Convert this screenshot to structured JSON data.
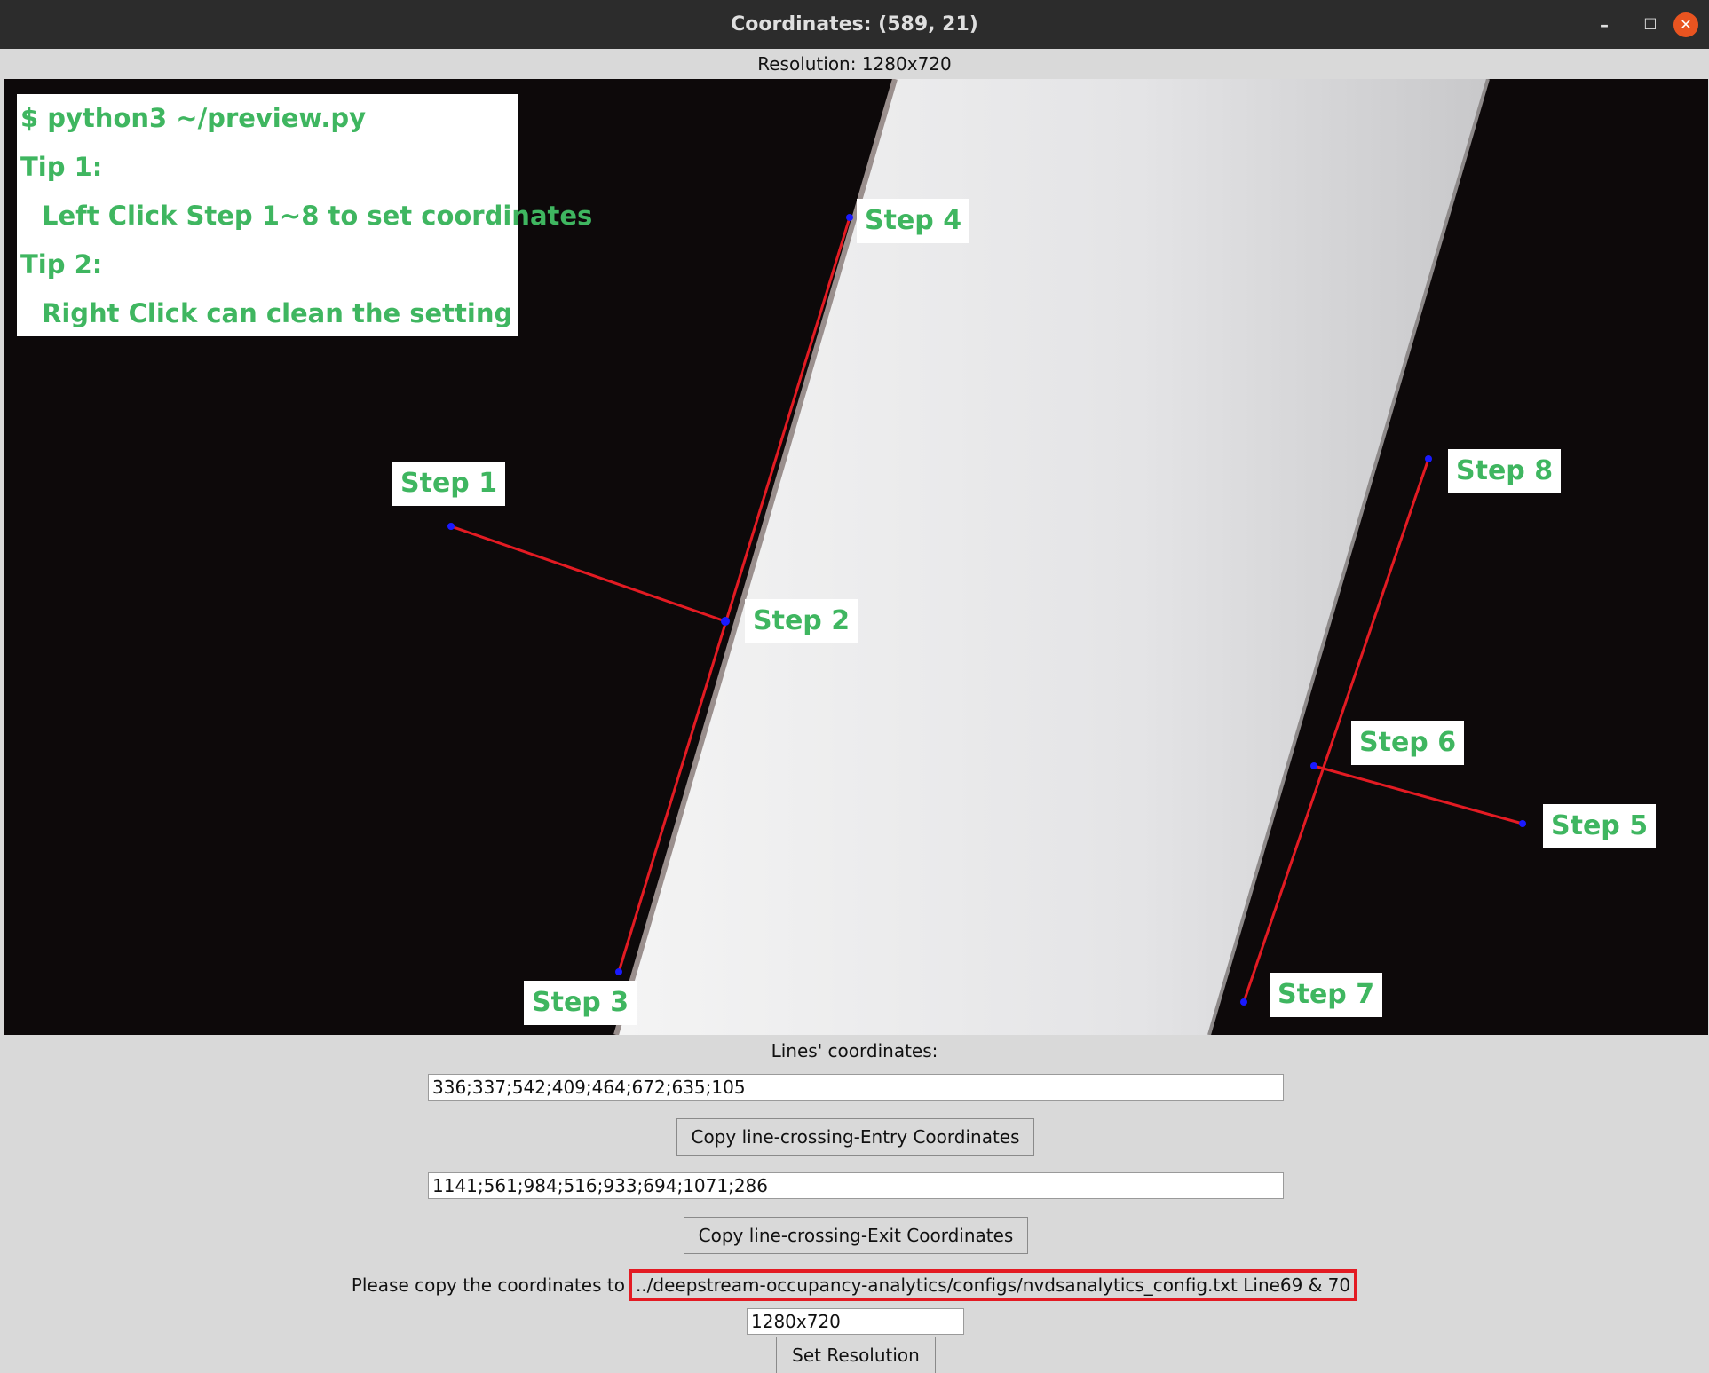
{
  "window": {
    "title": "Coordinates: (589, 21)",
    "minimize_glyph": "–",
    "maximize_glyph": "☐",
    "close_glyph": "✕"
  },
  "resolution_label": "Resolution: 1280x720",
  "overlay": {
    "command": "$ python3 ~/preview.py",
    "tip1_title": "Tip 1:",
    "tip1_text": "Left Click Step 1~8 to set coordinates",
    "tip2_title": "Tip 2:",
    "tip2_text": "Right Click can clean the setting"
  },
  "steps": {
    "s1": "Step 1",
    "s2": "Step 2",
    "s3": "Step 3",
    "s4": "Step 4",
    "s5": "Step 5",
    "s6": "Step 6",
    "s7": "Step 7",
    "s8": "Step 8"
  },
  "colors": {
    "line": "#e31b23",
    "point": "#1a1aff",
    "text_green": "#3fb660"
  },
  "form": {
    "lines_label": "Lines' coordinates:",
    "entry_value": "336;337;542;409;464;672;635;105",
    "entry_button": "Copy line-crossing-Entry Coordinates",
    "exit_value": "1141;561;984;516;933;694;1071;286",
    "exit_button": "Copy line-crossing-Exit Coordinates",
    "copy_prefix": "Please copy the coordinates to",
    "config_path": "../deepstream-occupancy-analytics/configs/nvdsanalytics_config.txt Line69 & 70",
    "resolution_value": "1280x720",
    "set_button": "Set Resolution"
  }
}
